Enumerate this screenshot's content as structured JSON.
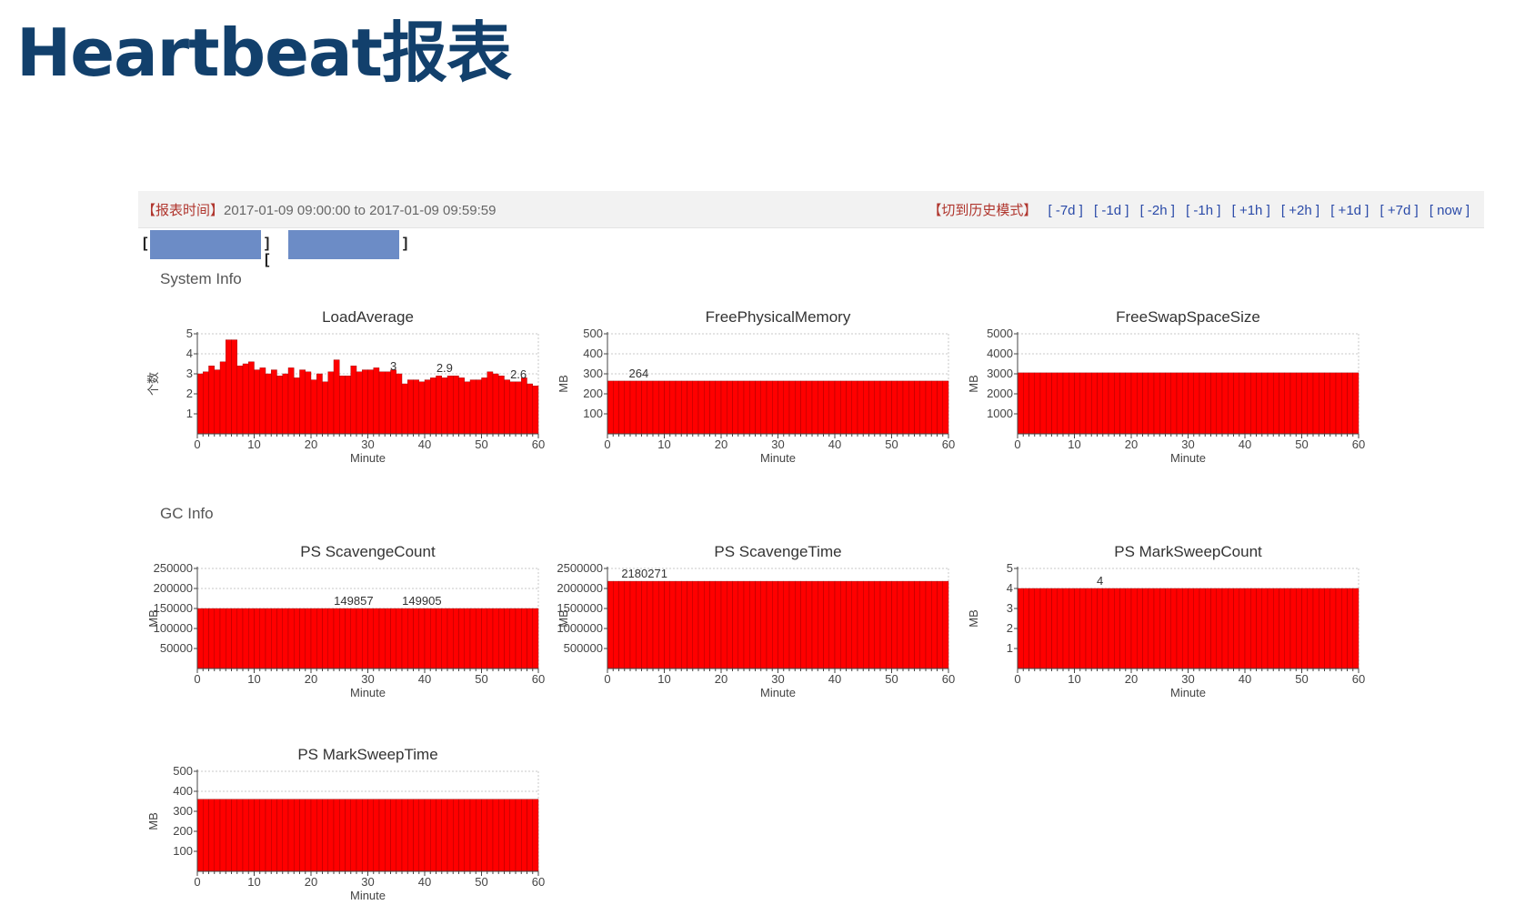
{
  "slide": {
    "title": "Heartbeat报表"
  },
  "report_bar": {
    "time_label": "【报表时间】",
    "time_range": "2017-01-09 09:00:00 to 2017-01-09 09:59:59",
    "history_label": "【切到历史模式】",
    "nav_links": [
      "[ -7d ]",
      "[ -1d ]",
      "[ -2h ]",
      "[ -1h ]",
      "[ +1h ]",
      "[ +2h ]",
      "[ +1d ]",
      "[ +7d ]",
      "[ now ]"
    ]
  },
  "host_selector": {
    "open": "[",
    "separator": "] [",
    "close": "]",
    "box_color": "#6c8cc6"
  },
  "sections": {
    "system": "System Info",
    "gc": "GC Info"
  },
  "colors": {
    "bar": "#ff0000",
    "bar_edge": "#9a0000"
  },
  "chart_data": [
    {
      "type": "bar",
      "title": "LoadAverage",
      "xlabel": "Minute",
      "ylabel": "个数",
      "xlim": [
        0,
        60
      ],
      "xticks": [
        0,
        10,
        20,
        30,
        40,
        50,
        60
      ],
      "ylim": [
        0,
        5
      ],
      "yticks": [
        1,
        2,
        3,
        4,
        5
      ],
      "grid": true,
      "values": [
        3.0,
        3.1,
        3.4,
        3.2,
        3.6,
        4.7,
        4.7,
        3.4,
        3.5,
        3.6,
        3.2,
        3.3,
        3.0,
        3.2,
        2.9,
        3.0,
        3.3,
        2.8,
        3.2,
        3.1,
        2.7,
        3.0,
        2.6,
        3.1,
        3.7,
        2.9,
        2.9,
        3.4,
        3.1,
        3.2,
        3.2,
        3.3,
        3.1,
        3.1,
        3.2,
        3.0,
        2.5,
        2.7,
        2.7,
        2.6,
        2.7,
        2.8,
        2.9,
        2.8,
        2.9,
        2.9,
        2.8,
        2.6,
        2.7,
        2.7,
        2.8,
        3.1,
        3.0,
        2.9,
        2.7,
        2.6,
        2.6,
        2.8,
        2.5,
        2.4
      ],
      "annotations": [
        {
          "x": 34.5,
          "y": 3.0,
          "label": "3"
        },
        {
          "x": 43.5,
          "y": 2.9,
          "label": "2.9"
        },
        {
          "x": 56.5,
          "y": 2.6,
          "label": "2.6"
        }
      ]
    },
    {
      "type": "bar",
      "title": "FreePhysicalMemory",
      "xlabel": "Minute",
      "ylabel": "MB",
      "xlim": [
        0,
        60
      ],
      "xticks": [
        0,
        10,
        20,
        30,
        40,
        50,
        60
      ],
      "ylim": [
        0,
        500
      ],
      "yticks": [
        100,
        200,
        300,
        400,
        500
      ],
      "grid": true,
      "constant": 264,
      "count": 60,
      "annotations": [
        {
          "x": 5.5,
          "y": 264,
          "label": "264"
        }
      ]
    },
    {
      "type": "bar",
      "title": "FreeSwapSpaceSize",
      "xlabel": "Minute",
      "ylabel": "MB",
      "xlim": [
        0,
        60
      ],
      "xticks": [
        0,
        10,
        20,
        30,
        40,
        50,
        60
      ],
      "ylim": [
        0,
        5000
      ],
      "yticks": [
        1000,
        2000,
        3000,
        4000,
        5000
      ],
      "grid": true,
      "constant": 3050,
      "count": 60,
      "annotations": []
    },
    {
      "type": "bar",
      "title": "PS ScavengeCount",
      "xlabel": "Minute",
      "ylabel": "MB",
      "xlim": [
        0,
        60
      ],
      "xticks": [
        0,
        10,
        20,
        30,
        40,
        50,
        60
      ],
      "ylim": [
        0,
        250000
      ],
      "yticks": [
        50000,
        100000,
        150000,
        200000,
        250000
      ],
      "grid": true,
      "constant": 149880,
      "count": 60,
      "annotations": [
        {
          "x": 27.5,
          "y": 149857,
          "label": "149857"
        },
        {
          "x": 39.5,
          "y": 149905,
          "label": "149905"
        }
      ]
    },
    {
      "type": "bar",
      "title": "PS ScavengeTime",
      "xlabel": "Minute",
      "ylabel": "MB",
      "xlim": [
        0,
        60
      ],
      "xticks": [
        0,
        10,
        20,
        30,
        40,
        50,
        60
      ],
      "ylim": [
        0,
        2500000
      ],
      "yticks": [
        500000,
        1000000,
        1500000,
        2000000,
        2500000
      ],
      "grid": true,
      "constant": 2180271,
      "count": 60,
      "annotations": [
        {
          "x": 6.5,
          "y": 2180271,
          "label": "2180271"
        }
      ]
    },
    {
      "type": "bar",
      "title": "PS MarkSweepCount",
      "xlabel": "Minute",
      "ylabel": "MB",
      "xlim": [
        0,
        60
      ],
      "xticks": [
        0,
        10,
        20,
        30,
        40,
        50,
        60
      ],
      "ylim": [
        0,
        5
      ],
      "yticks": [
        1,
        2,
        3,
        4,
        5
      ],
      "grid": true,
      "constant": 4,
      "count": 60,
      "annotations": [
        {
          "x": 14.5,
          "y": 4,
          "label": "4"
        }
      ]
    },
    {
      "type": "bar",
      "title": "PS MarkSweepTime",
      "xlabel": "Minute",
      "ylabel": "MB",
      "xlim": [
        0,
        60
      ],
      "xticks": [
        0,
        10,
        20,
        30,
        40,
        50,
        60
      ],
      "ylim": [
        0,
        500
      ],
      "yticks": [
        100,
        200,
        300,
        400,
        500
      ],
      "grid": true,
      "constant": 360,
      "count": 60,
      "annotations": []
    }
  ]
}
